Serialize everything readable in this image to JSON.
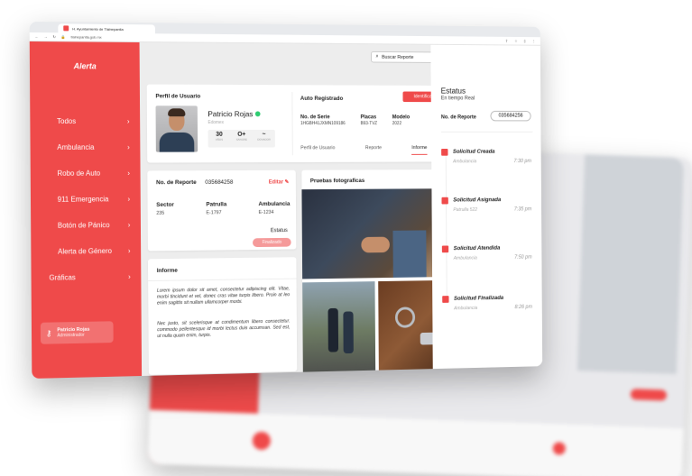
{
  "browser": {
    "tab_title": "H. Ayuntamiento de Tlalnepantla",
    "url": "tlalnepantla.gob.mx"
  },
  "sidebar": {
    "brand": "Alerta",
    "items": [
      {
        "label": "Todos"
      },
      {
        "label": "Ambulancia"
      },
      {
        "label": "Robo de Auto"
      },
      {
        "label": "911 Emergencia"
      },
      {
        "label": "Botón de Pánico"
      },
      {
        "label": "Alerta de Género"
      },
      {
        "label": "Gráficas"
      }
    ],
    "user": {
      "name": "Patricio Rojas",
      "role": "Administrador"
    }
  },
  "header": {
    "search_placeholder": "Buscar Reporte"
  },
  "profile": {
    "title": "Perfil de Usuario",
    "name": "Patricio Rojas",
    "subtitle": "Edomex",
    "stats": [
      {
        "value": "30",
        "label": "AÑOS"
      },
      {
        "value": "O+",
        "label": "SANGRE"
      },
      {
        "value": "~",
        "label": "DONADOR"
      }
    ]
  },
  "auto": {
    "title": "Auto Registrado",
    "button": "Identificación",
    "fields": [
      {
        "key": "No. de Serie",
        "value": "1HGBH41JXMN109186"
      },
      {
        "key": "Placas",
        "value": "B93-TVZ"
      },
      {
        "key": "Modelo",
        "value": "2022"
      }
    ],
    "tabs": [
      "Perfil de Usuario",
      "Reporte",
      "Informe"
    ],
    "active_tab": "Informe"
  },
  "reporte": {
    "label": "No. de Reporte",
    "number": "035684258",
    "edit": "Editar",
    "fields": [
      {
        "key": "Sector",
        "value": "235"
      },
      {
        "key": "Patrulla",
        "value": "E-1797"
      },
      {
        "key": "Ambulancia",
        "value": "E-1234"
      }
    ],
    "estatus_label": "Estatus",
    "estatus_value": "Finalizado"
  },
  "informe": {
    "title": "Informe",
    "p1": "Lorem ipsum dolor sit amet, consectetur adipiscing elit. Vitae, morbi tincidunt et vel, donec cras vitae turpis libero. Proin at leo enim sagittis sit nullam ullamcorper morbi.",
    "p2": "Nec justo, sit scelerisque at condimentum libero consectetur. commodo pellentesque id morbi lectus duis accumsan. Sed est, ut nulla quam enim, turpis."
  },
  "fotos": {
    "title": "Pruebas fotograficas"
  },
  "estatus": {
    "title": "Estatus",
    "subtitle": "En tiempo Real",
    "report_label": "No. de Reporte",
    "report_number": "035684256",
    "events": [
      {
        "title": "Solicitud Creada",
        "sub": "Ambulancia",
        "time": "7:30 pm"
      },
      {
        "title": "Solicitud Asignada",
        "sub": "Patrulla 522",
        "time": "7:35 pm"
      },
      {
        "title": "Solicitud Atendida",
        "sub": "Ambulancia",
        "time": "7:50 pm"
      },
      {
        "title": "Solicitud Finalizada",
        "sub": "Ambulancia",
        "time": "8:26 pm"
      }
    ]
  },
  "colors": {
    "accent": "#ef4a4a",
    "status_pill": "#f59a9a"
  }
}
